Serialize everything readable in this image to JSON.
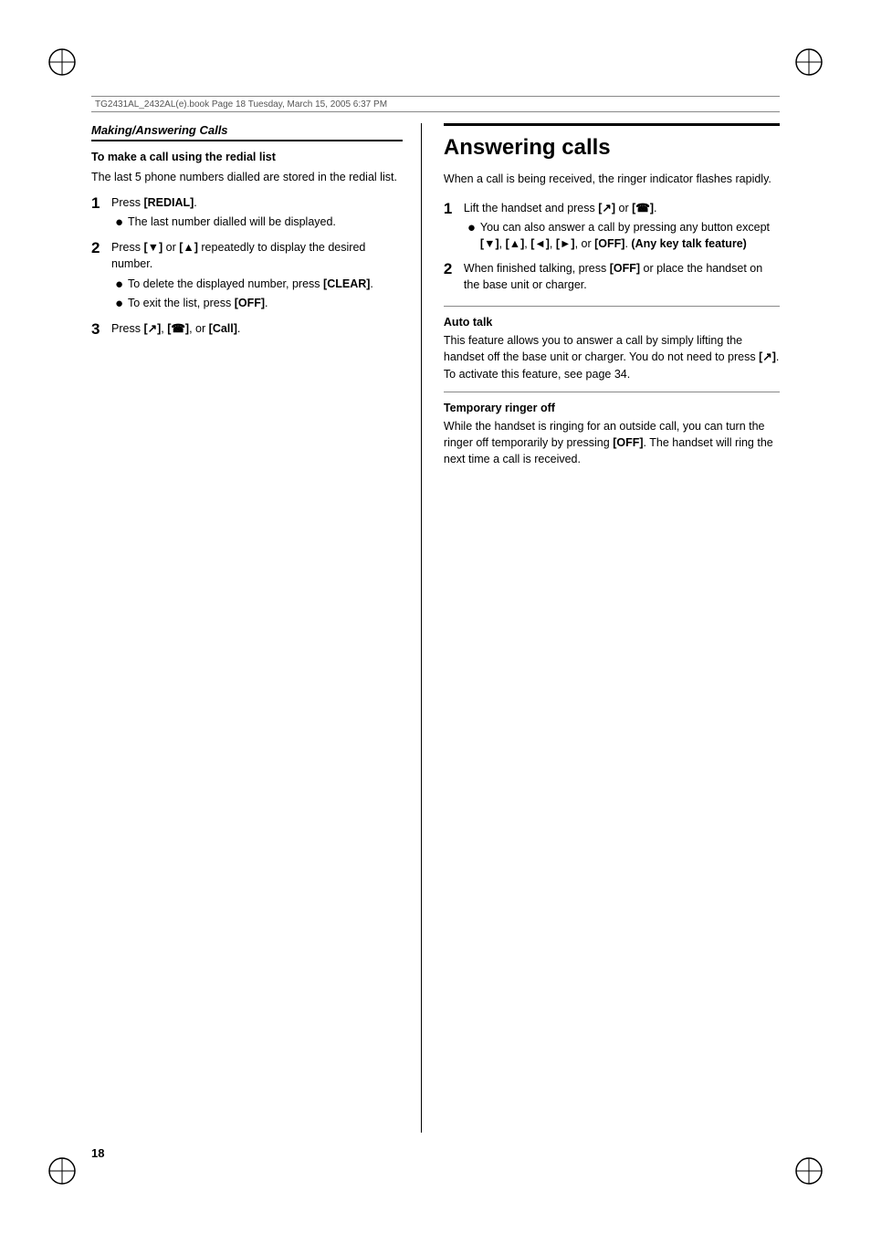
{
  "page": {
    "header_text": "TG2431AL_2432AL(e).book  Page 18  Tuesday, March 15, 2005  6:37 PM",
    "page_number": "18",
    "left_section_heading": "Making/Answering Calls",
    "left_sub_heading": "To make a call using the redial list",
    "left_intro": "The last 5 phone numbers dialled are stored in the redial list.",
    "step1_number": "1",
    "step1_main": "Press [REDIAL].",
    "step1_bullet1": "The last number dialled will be displayed.",
    "step2_number": "2",
    "step2_main": "Press [▼] or [▲] repeatedly to display the desired number.",
    "step2_bullet1": "To delete the displayed number, press [CLEAR].",
    "step2_bullet2": "To exit the list, press [OFF].",
    "step3_number": "3",
    "step3_main": "Press [↗], [☎], or [Call].",
    "right_title": "Answering calls",
    "right_intro": "When a call is being received, the ringer indicator flashes rapidly.",
    "right_step1_number": "1",
    "right_step1_main": "Lift the handset and press [↗] or [☎].",
    "right_step1_bullet1": "You can also answer a call by pressing any button except [▼], [▲], [◄], [►], or [OFF]. (Any key talk feature)",
    "right_step2_number": "2",
    "right_step2_main": "When finished talking, press [OFF] or place the handset on the base unit or charger.",
    "auto_talk_heading": "Auto talk",
    "auto_talk_body": "This feature allows you to answer a call by simply lifting the handset off the base unit or charger. You do not need to press [↗]. To activate this feature, see page 34.",
    "temp_ringer_heading": "Temporary ringer off",
    "temp_ringer_body": "While the handset is ringing for an outside call, you can turn the ringer off temporarily by pressing [OFF]. The handset will ring the next time a call is received."
  }
}
